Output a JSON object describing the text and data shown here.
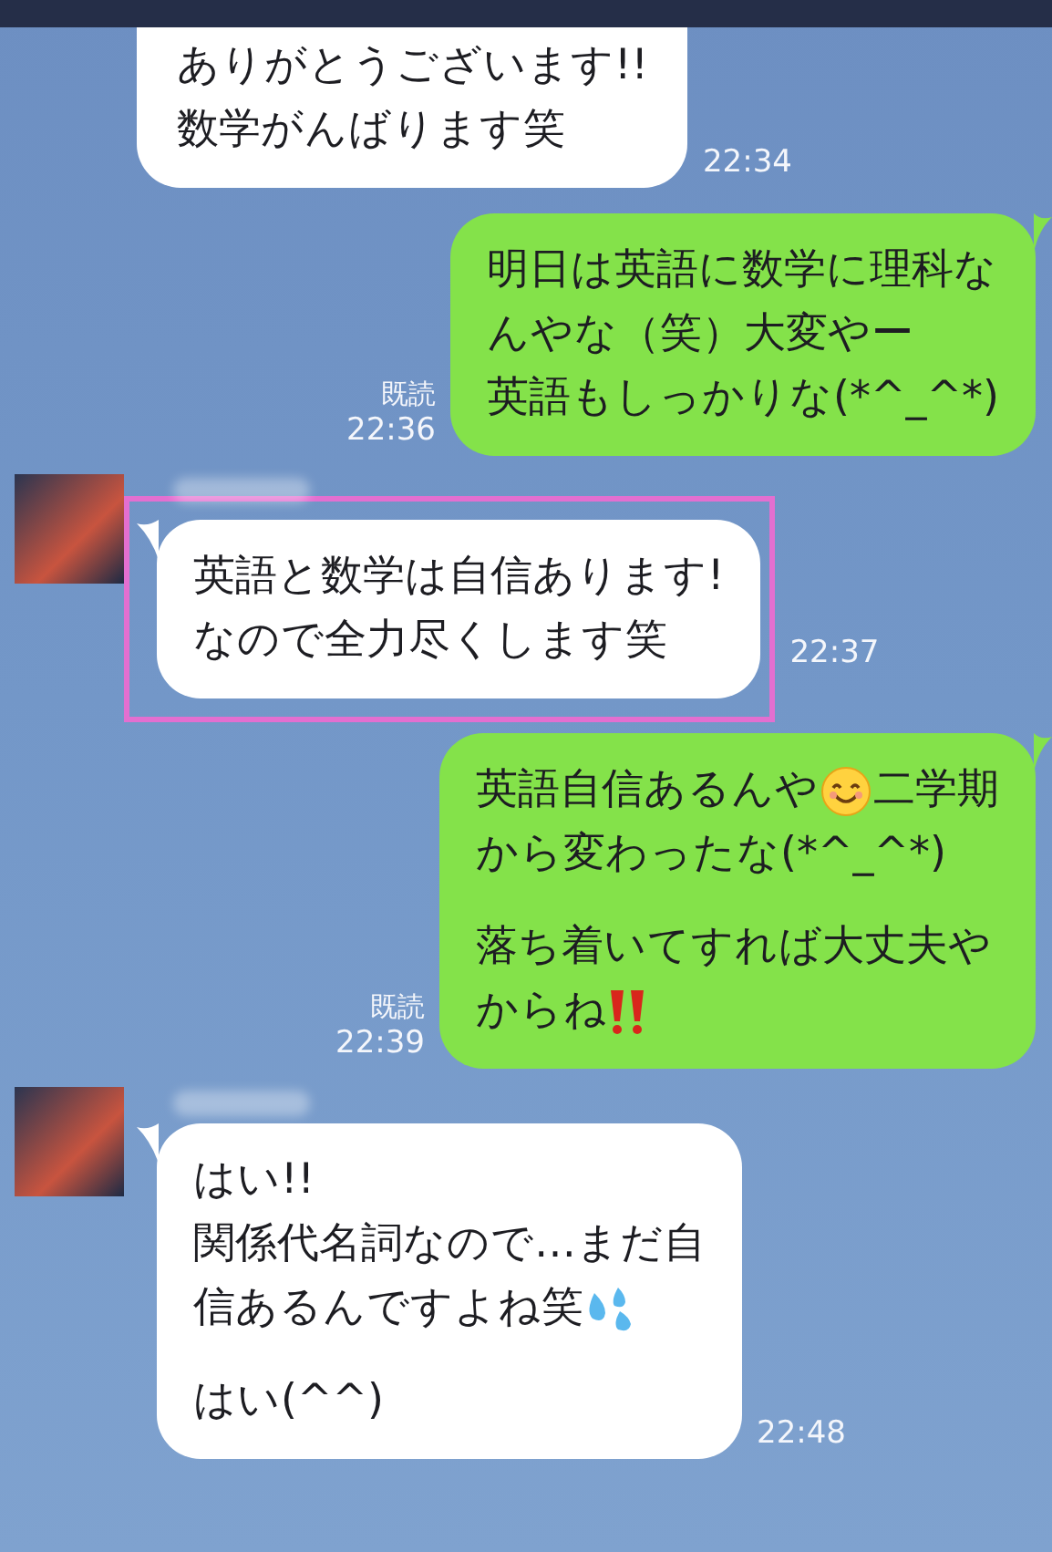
{
  "messages": [
    {
      "kind": "incoming",
      "avatar": false,
      "highlighted": false,
      "time": "22:34",
      "paragraphs": [
        [
          [
            {
              "kind": "text",
              "text": "ありがとうございます!!"
            }
          ],
          [
            {
              "kind": "text",
              "text": "数学がんばります笑"
            }
          ]
        ]
      ]
    },
    {
      "kind": "outgoing",
      "read": "既読",
      "time": "22:36",
      "paragraphs": [
        [
          [
            {
              "kind": "text",
              "text": "明日は英語に数学に理科な"
            }
          ],
          [
            {
              "kind": "text",
              "text": "んやな（笑）大変やー"
            }
          ],
          [
            {
              "kind": "text",
              "text": "英語もしっかりな(*^_^*)"
            }
          ]
        ]
      ]
    },
    {
      "kind": "incoming",
      "avatar": true,
      "highlighted": true,
      "time": "22:37",
      "paragraphs": [
        [
          [
            {
              "kind": "text",
              "text": "英語と数学は自信あります!"
            }
          ],
          [
            {
              "kind": "text",
              "text": "なので全力尽くします笑"
            }
          ]
        ]
      ]
    },
    {
      "kind": "outgoing",
      "read": "既読",
      "time": "22:39",
      "paragraphs": [
        [
          [
            {
              "kind": "text",
              "text": "英語自信あるんや"
            },
            {
              "kind": "smile"
            },
            {
              "kind": "text",
              "text": "二学期"
            }
          ],
          [
            {
              "kind": "text",
              "text": "から変わったな(*^_^*)"
            }
          ]
        ],
        [
          [
            {
              "kind": "text",
              "text": "落ち着いてすれば大丈夫や"
            }
          ],
          [
            {
              "kind": "text",
              "text": "からね"
            },
            {
              "kind": "exclaim"
            }
          ]
        ]
      ]
    },
    {
      "kind": "incoming",
      "avatar": true,
      "highlighted": false,
      "time": "22:48",
      "paragraphs": [
        [
          [
            {
              "kind": "text",
              "text": "はい!!"
            }
          ],
          [
            {
              "kind": "text",
              "text": "関係代名詞なので…まだ自"
            }
          ],
          [
            {
              "kind": "text",
              "text": "信あるんですよね笑"
            },
            {
              "kind": "sweat"
            }
          ]
        ],
        [
          [
            {
              "kind": "text",
              "text": "はい(^^)"
            }
          ]
        ]
      ]
    }
  ]
}
